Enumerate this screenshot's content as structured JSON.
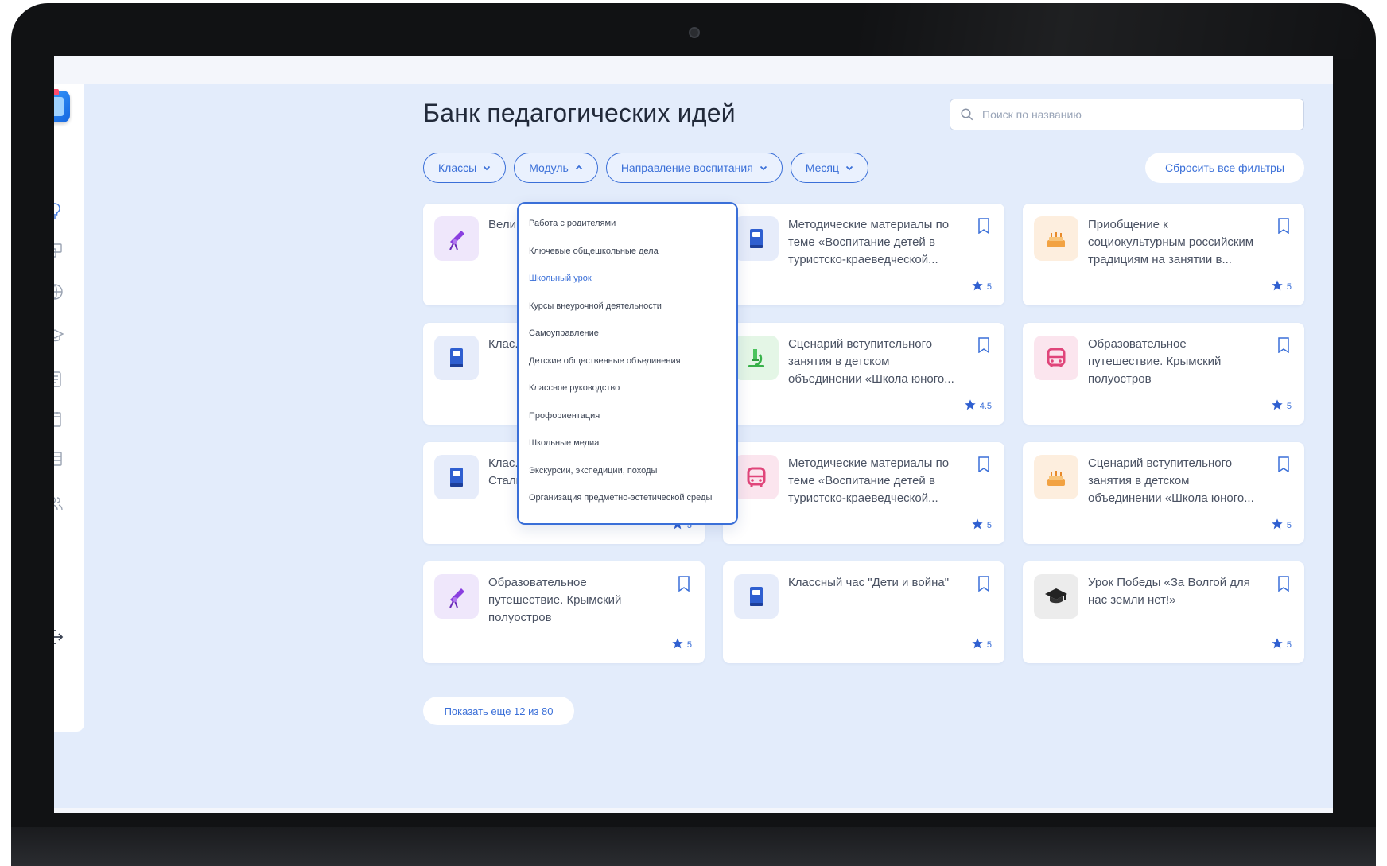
{
  "page": {
    "title": "Банк педагогических идей"
  },
  "search": {
    "placeholder": "Поиск по названию"
  },
  "filters": [
    {
      "label": "Классы",
      "open": false
    },
    {
      "label": "Модуль",
      "open": true
    },
    {
      "label": "Направление воспитания",
      "open": false
    },
    {
      "label": "Месяц",
      "open": false
    }
  ],
  "reset_label": "Сбросить все фильтры",
  "dropdown": {
    "items": [
      "Работа с родителями",
      "Ключевые общешкольные дела",
      "Школьный урок",
      "Курсы внеурочной деятельности",
      "Самоуправление",
      "Детские общественные объединения",
      "Классное руководство",
      "Профориентация",
      "Школьные медиа",
      "Экскурсии, экспедиции, походы",
      "Организация предметно-эстетической среды"
    ],
    "active": "Школьный урок"
  },
  "cards": [
    {
      "title": "Вели... Алек...",
      "icon": "telescope-icon",
      "color": "purple",
      "rating": ""
    },
    {
      "title": "Методические материалы по теме «Воспитание детей в туристско-краеведческой...",
      "icon": "book-icon",
      "color": "blue",
      "rating": "5"
    },
    {
      "title": "Приобщение к социокультурным российским традициям на занятии в...",
      "icon": "cake-icon",
      "color": "orange",
      "rating": "5"
    },
    {
      "title": "Клас... пеш...",
      "icon": "book-icon",
      "color": "blue",
      "rating": ""
    },
    {
      "title": "Сценарий вступительного занятия в детском объединении «Школа юного...",
      "icon": "microscope-icon",
      "color": "green",
      "rating": "4.5"
    },
    {
      "title": "Образовательное путешествие. Крымский полуостров",
      "icon": "bus-icon",
      "color": "pink",
      "rating": "5"
    },
    {
      "title": "Клас... победе в Сталинградской битве",
      "icon": "book-icon",
      "color": "blue",
      "rating": "5"
    },
    {
      "title": "Методические материалы по теме «Воспитание детей в туристско-краеведческой...",
      "icon": "bus-icon",
      "color": "pink",
      "rating": "5"
    },
    {
      "title": "Сценарий вступительного занятия в детском объединении «Школа юного...",
      "icon": "cake-icon",
      "color": "orange",
      "rating": "5"
    },
    {
      "title": "Образовательное путешествие. Крымский полуостров",
      "icon": "telescope-icon",
      "color": "purple",
      "rating": "5"
    },
    {
      "title": "Классный час \"Дети и война\"",
      "icon": "book-icon",
      "color": "blue",
      "rating": "5"
    },
    {
      "title": "Урок Победы «За Волгой для нас земли нет!»",
      "icon": "graduation-cap-icon",
      "color": "grey",
      "rating": "5"
    }
  ],
  "show_more_label": "Показать еще 12 из 80",
  "sidebar": {
    "icons": [
      "lightbulb-icon",
      "presentation-icon",
      "globe-icon",
      "graduation-cap-icon",
      "document-icon",
      "calendar-icon",
      "table-icon",
      "users-icon",
      "logout-icon"
    ]
  },
  "colors": {
    "accent": "#3a6fd8",
    "background": "#e3ecfb"
  }
}
